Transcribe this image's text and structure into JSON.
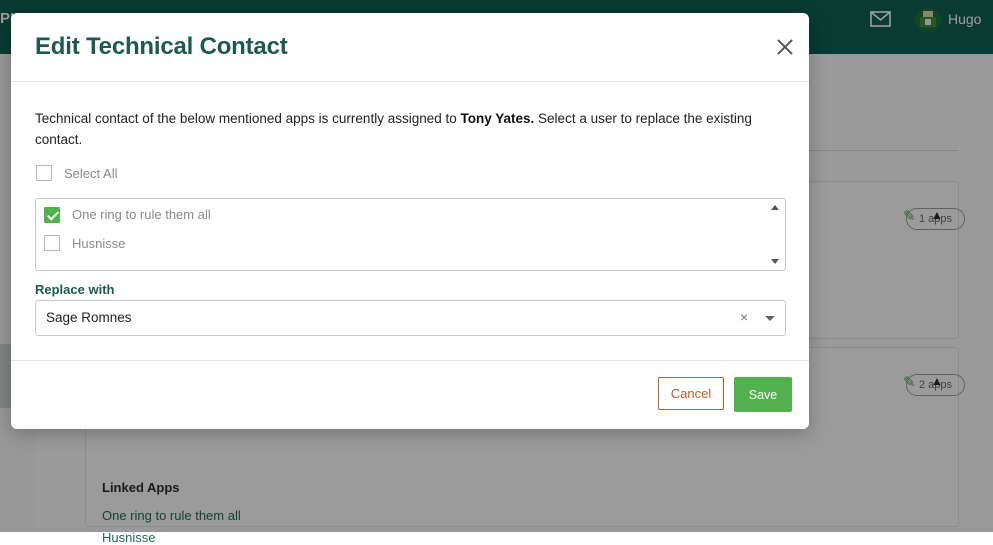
{
  "topbar": {
    "brand": "PI",
    "user_name": "Hugo"
  },
  "cards": [
    {
      "badge": "1 apps"
    },
    {
      "badge": "2 apps",
      "linked_title": "Linked Apps",
      "linked_items": [
        "One ring to rule them all",
        "Husnisse"
      ]
    }
  ],
  "modal": {
    "title": "Edit Technical Contact",
    "description_prefix": "Technical contact of the below mentioned apps is currently assigned to ",
    "current_contact": "Tony Yates.",
    "description_suffix": " Select a user to replace the existing contact.",
    "select_all_label": "Select All",
    "select_all_checked": false,
    "apps": [
      {
        "label": "One ring to rule them all",
        "checked": true
      },
      {
        "label": "Husnisse",
        "checked": false
      }
    ],
    "replace_label": "Replace with",
    "replace_value": "Sage Romnes",
    "clear_glyph": "×",
    "cancel_label": "Cancel",
    "save_label": "Save"
  },
  "colors": {
    "brand": "#0e5f4f",
    "accent_green": "#52b04f",
    "title": "#1d5a4f",
    "cancel": "#c45a2a"
  }
}
